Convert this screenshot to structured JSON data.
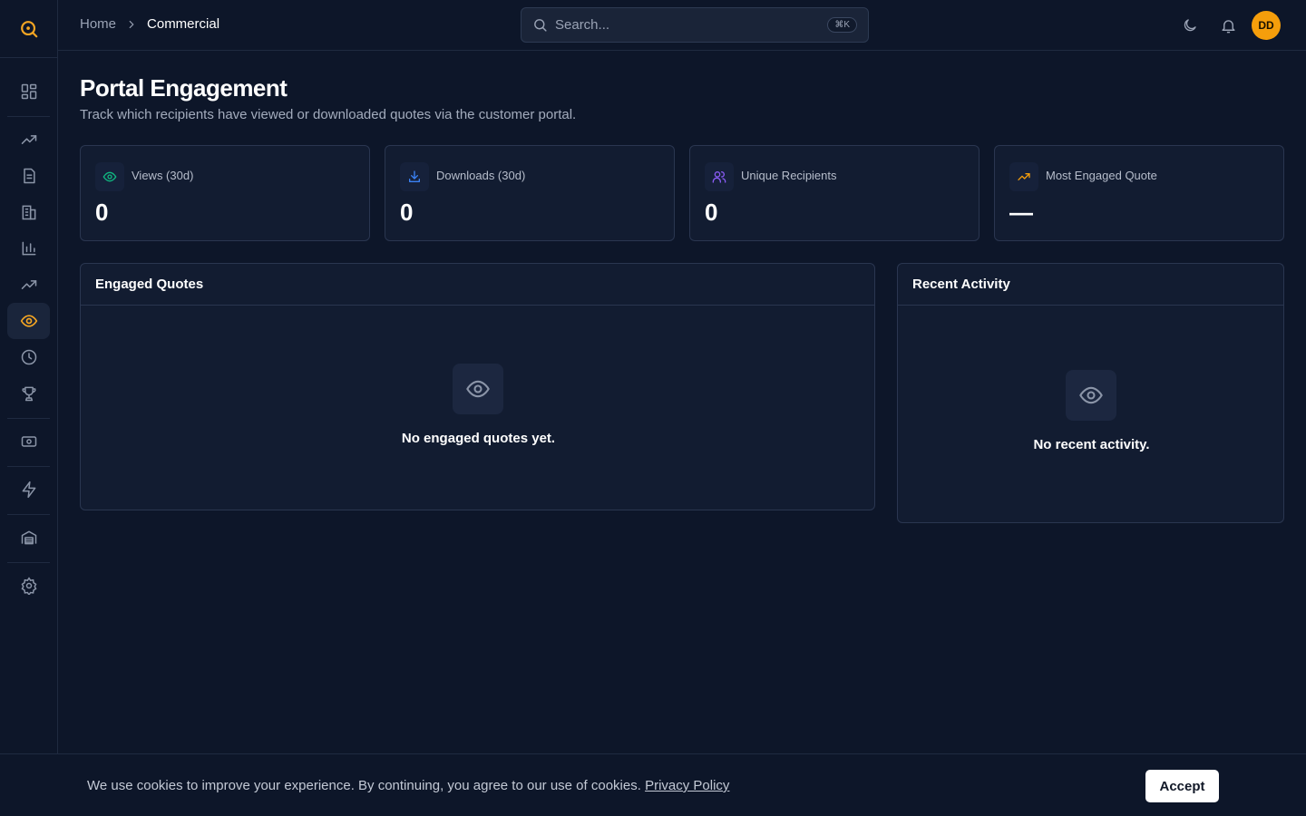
{
  "breadcrumb": {
    "home": "Home",
    "current": "Commercial"
  },
  "search": {
    "placeholder": "Search...",
    "shortcut": "⌘K"
  },
  "user": {
    "initials": "DD"
  },
  "page": {
    "title": "Portal Engagement",
    "subtitle": "Track which recipients have viewed or downloaded quotes via the customer portal."
  },
  "stats": [
    {
      "label": "Views (30d)",
      "value": "0",
      "icon": "eye-icon",
      "color": "#10b981"
    },
    {
      "label": "Downloads (30d)",
      "value": "0",
      "icon": "download-icon",
      "color": "#3b82f6"
    },
    {
      "label": "Unique Recipients",
      "value": "0",
      "icon": "users-icon",
      "color": "#8b5cf6"
    },
    {
      "label": "Most Engaged Quote",
      "value": "—",
      "icon": "trending-up-icon",
      "color": "#f59e0b"
    }
  ],
  "engaged_quotes": {
    "title": "Engaged Quotes",
    "empty": "No engaged quotes yet."
  },
  "recent_activity": {
    "title": "Recent Activity",
    "empty": "No recent activity."
  },
  "cookie": {
    "message": "We use cookies to improve your experience. By continuing, you agree to our use of cookies.",
    "link": "Privacy Policy",
    "accept": "Accept"
  },
  "colors": {
    "accent": "#f5a623",
    "background": "#0d1629",
    "card": "#121c31"
  }
}
